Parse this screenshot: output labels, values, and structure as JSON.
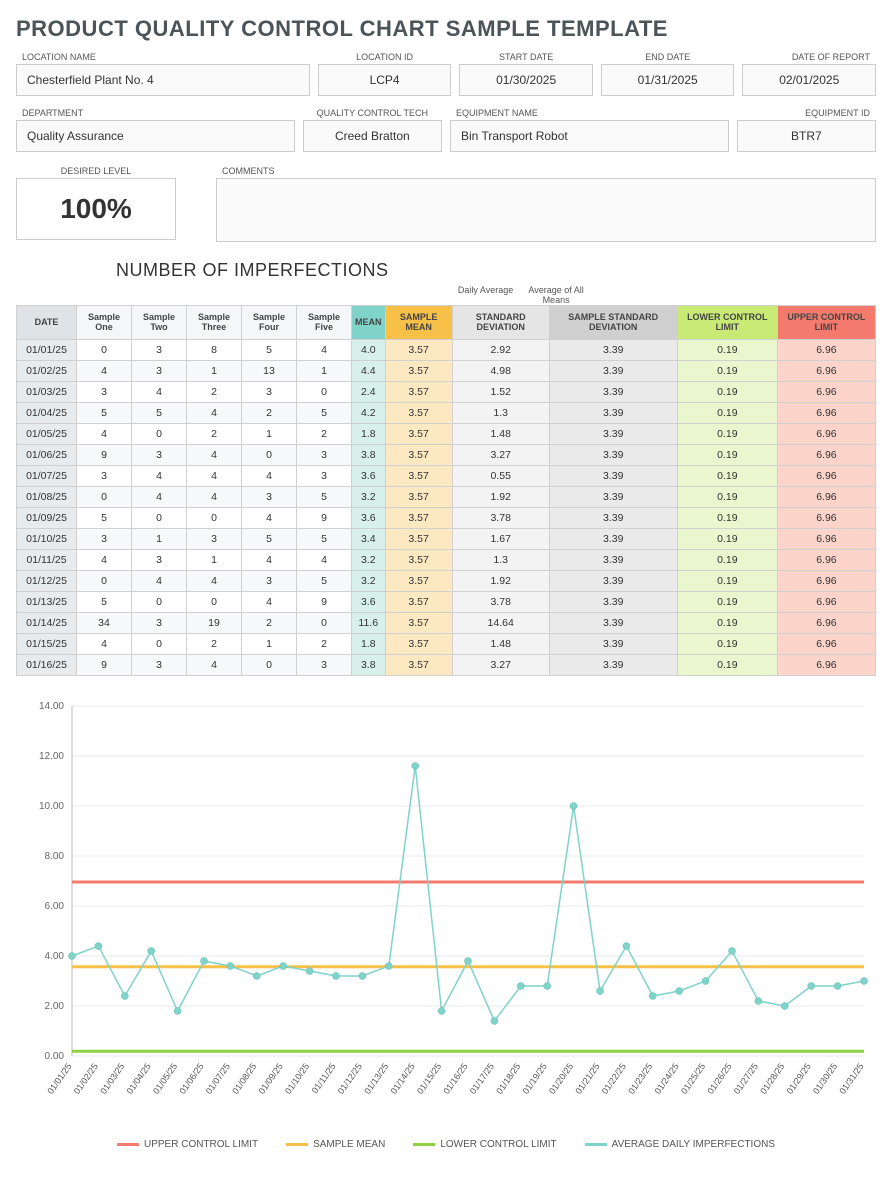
{
  "title": "PRODUCT QUALITY CONTROL CHART SAMPLE TEMPLATE",
  "fields1": {
    "location_name": {
      "label": "LOCATION NAME",
      "value": "Chesterfield Plant No. 4"
    },
    "location_id": {
      "label": "LOCATION ID",
      "value": "LCP4"
    },
    "start_date": {
      "label": "START DATE",
      "value": "01/30/2025"
    },
    "end_date": {
      "label": "END DATE",
      "value": "01/31/2025"
    },
    "report_date": {
      "label": "DATE OF REPORT",
      "value": "02/01/2025"
    }
  },
  "fields2": {
    "department": {
      "label": "DEPARTMENT",
      "value": "Quality Assurance"
    },
    "qc_tech": {
      "label": "QUALITY CONTROL TECH",
      "value": "Creed Bratton"
    },
    "equip_name": {
      "label": "EQUIPMENT NAME",
      "value": "Bin Transport Robot"
    },
    "equip_id": {
      "label": "EQUIPMENT ID",
      "value": "BTR7"
    }
  },
  "desired": {
    "label": "DESIRED LEVEL",
    "value": "100%"
  },
  "comments": {
    "label": "COMMENTS",
    "value": ""
  },
  "table": {
    "title": "NUMBER OF IMPERFECTIONS",
    "supheader_daily": "Daily Average",
    "supheader_all": "Average of All Means",
    "headers": {
      "date": "DATE",
      "s1": "Sample One",
      "s2": "Sample Two",
      "s3": "Sample Three",
      "s4": "Sample Four",
      "s5": "Sample Five",
      "mean": "MEAN",
      "smean": "SAMPLE MEAN",
      "std": "STANDARD DEVIATION",
      "sstd": "SAMPLE STANDARD DEVIATION",
      "lcl": "LOWER CONTROL LIMIT",
      "ucl": "UPPER CONTROL LIMIT"
    },
    "rows": [
      {
        "date": "01/01/25",
        "s1": 0,
        "s2": 3,
        "s3": 8,
        "s4": 5,
        "s5": 4,
        "mean": 4.0,
        "smean": 3.57,
        "std": 2.92,
        "sstd": 3.39,
        "lcl": 0.19,
        "ucl": 6.96
      },
      {
        "date": "01/02/25",
        "s1": 4,
        "s2": 3,
        "s3": 1,
        "s4": 13,
        "s5": 1,
        "mean": 4.4,
        "smean": 3.57,
        "std": 4.98,
        "sstd": 3.39,
        "lcl": 0.19,
        "ucl": 6.96
      },
      {
        "date": "01/03/25",
        "s1": 3,
        "s2": 4,
        "s3": 2,
        "s4": 3,
        "s5": 0,
        "mean": 2.4,
        "smean": 3.57,
        "std": 1.52,
        "sstd": 3.39,
        "lcl": 0.19,
        "ucl": 6.96
      },
      {
        "date": "01/04/25",
        "s1": 5,
        "s2": 5,
        "s3": 4,
        "s4": 2,
        "s5": 5,
        "mean": 4.2,
        "smean": 3.57,
        "std": 1.3,
        "sstd": 3.39,
        "lcl": 0.19,
        "ucl": 6.96
      },
      {
        "date": "01/05/25",
        "s1": 4,
        "s2": 0,
        "s3": 2,
        "s4": 1,
        "s5": 2,
        "mean": 1.8,
        "smean": 3.57,
        "std": 1.48,
        "sstd": 3.39,
        "lcl": 0.19,
        "ucl": 6.96
      },
      {
        "date": "01/06/25",
        "s1": 9,
        "s2": 3,
        "s3": 4,
        "s4": 0,
        "s5": 3,
        "mean": 3.8,
        "smean": 3.57,
        "std": 3.27,
        "sstd": 3.39,
        "lcl": 0.19,
        "ucl": 6.96
      },
      {
        "date": "01/07/25",
        "s1": 3,
        "s2": 4,
        "s3": 4,
        "s4": 4,
        "s5": 3,
        "mean": 3.6,
        "smean": 3.57,
        "std": 0.55,
        "sstd": 3.39,
        "lcl": 0.19,
        "ucl": 6.96
      },
      {
        "date": "01/08/25",
        "s1": 0,
        "s2": 4,
        "s3": 4,
        "s4": 3,
        "s5": 5,
        "mean": 3.2,
        "smean": 3.57,
        "std": 1.92,
        "sstd": 3.39,
        "lcl": 0.19,
        "ucl": 6.96
      },
      {
        "date": "01/09/25",
        "s1": 5,
        "s2": 0,
        "s3": 0,
        "s4": 4,
        "s5": 9,
        "mean": 3.6,
        "smean": 3.57,
        "std": 3.78,
        "sstd": 3.39,
        "lcl": 0.19,
        "ucl": 6.96
      },
      {
        "date": "01/10/25",
        "s1": 3,
        "s2": 1,
        "s3": 3,
        "s4": 5,
        "s5": 5,
        "mean": 3.4,
        "smean": 3.57,
        "std": 1.67,
        "sstd": 3.39,
        "lcl": 0.19,
        "ucl": 6.96
      },
      {
        "date": "01/11/25",
        "s1": 4,
        "s2": 3,
        "s3": 1,
        "s4": 4,
        "s5": 4,
        "mean": 3.2,
        "smean": 3.57,
        "std": 1.3,
        "sstd": 3.39,
        "lcl": 0.19,
        "ucl": 6.96
      },
      {
        "date": "01/12/25",
        "s1": 0,
        "s2": 4,
        "s3": 4,
        "s4": 3,
        "s5": 5,
        "mean": 3.2,
        "smean": 3.57,
        "std": 1.92,
        "sstd": 3.39,
        "lcl": 0.19,
        "ucl": 6.96
      },
      {
        "date": "01/13/25",
        "s1": 5,
        "s2": 0,
        "s3": 0,
        "s4": 4,
        "s5": 9,
        "mean": 3.6,
        "smean": 3.57,
        "std": 3.78,
        "sstd": 3.39,
        "lcl": 0.19,
        "ucl": 6.96
      },
      {
        "date": "01/14/25",
        "s1": 34,
        "s2": 3,
        "s3": 19,
        "s4": 2,
        "s5": 0,
        "mean": 11.6,
        "smean": 3.57,
        "std": 14.64,
        "sstd": 3.39,
        "lcl": 0.19,
        "ucl": 6.96
      },
      {
        "date": "01/15/25",
        "s1": 4,
        "s2": 0,
        "s3": 2,
        "s4": 1,
        "s5": 2,
        "mean": 1.8,
        "smean": 3.57,
        "std": 1.48,
        "sstd": 3.39,
        "lcl": 0.19,
        "ucl": 6.96
      },
      {
        "date": "01/16/25",
        "s1": 9,
        "s2": 3,
        "s3": 4,
        "s4": 0,
        "s5": 3,
        "mean": 3.8,
        "smean": 3.57,
        "std": 3.27,
        "sstd": 3.39,
        "lcl": 0.19,
        "ucl": 6.96
      }
    ]
  },
  "chart_data": {
    "type": "line",
    "title": "",
    "ylabel": "",
    "xlabel": "",
    "ylim": [
      0,
      14
    ],
    "yticks": [
      0,
      2,
      4,
      6,
      8,
      10,
      12,
      14
    ],
    "categories": [
      "01/01/25",
      "01/02/25",
      "01/03/25",
      "01/04/25",
      "01/05/25",
      "01/06/25",
      "01/07/25",
      "01/08/25",
      "01/09/25",
      "01/10/25",
      "01/11/25",
      "01/12/25",
      "01/13/25",
      "01/14/25",
      "01/15/25",
      "01/16/25",
      "01/17/25",
      "01/18/25",
      "01/19/25",
      "01/20/25",
      "01/21/25",
      "01/22/25",
      "01/23/25",
      "01/24/25",
      "01/25/25",
      "01/26/25",
      "01/27/25",
      "01/28/25",
      "01/29/25",
      "01/30/25",
      "01/31/25"
    ],
    "series": [
      {
        "name": "UPPER CONTROL LIMIT",
        "color": "#f47a6e",
        "values": [
          6.96,
          6.96,
          6.96,
          6.96,
          6.96,
          6.96,
          6.96,
          6.96,
          6.96,
          6.96,
          6.96,
          6.96,
          6.96,
          6.96,
          6.96,
          6.96,
          6.96,
          6.96,
          6.96,
          6.96,
          6.96,
          6.96,
          6.96,
          6.96,
          6.96,
          6.96,
          6.96,
          6.96,
          6.96,
          6.96,
          6.96
        ]
      },
      {
        "name": "SAMPLE MEAN",
        "color": "#f6c049",
        "values": [
          3.57,
          3.57,
          3.57,
          3.57,
          3.57,
          3.57,
          3.57,
          3.57,
          3.57,
          3.57,
          3.57,
          3.57,
          3.57,
          3.57,
          3.57,
          3.57,
          3.57,
          3.57,
          3.57,
          3.57,
          3.57,
          3.57,
          3.57,
          3.57,
          3.57,
          3.57,
          3.57,
          3.57,
          3.57,
          3.57,
          3.57
        ]
      },
      {
        "name": "LOWER CONTROL LIMIT",
        "color": "#8fd142",
        "values": [
          0.19,
          0.19,
          0.19,
          0.19,
          0.19,
          0.19,
          0.19,
          0.19,
          0.19,
          0.19,
          0.19,
          0.19,
          0.19,
          0.19,
          0.19,
          0.19,
          0.19,
          0.19,
          0.19,
          0.19,
          0.19,
          0.19,
          0.19,
          0.19,
          0.19,
          0.19,
          0.19,
          0.19,
          0.19,
          0.19,
          0.19
        ]
      },
      {
        "name": "AVERAGE DAILY IMPERFECTIONS",
        "color": "#7fd3c9",
        "values": [
          4.0,
          4.4,
          2.4,
          4.2,
          1.8,
          3.8,
          3.6,
          3.2,
          3.6,
          3.4,
          3.2,
          3.2,
          3.6,
          11.6,
          1.8,
          3.8,
          1.4,
          2.8,
          2.8,
          10.0,
          2.6,
          4.4,
          2.4,
          2.6,
          3.0,
          4.2,
          2.2,
          2.0,
          2.8,
          2.8,
          3.0
        ]
      }
    ],
    "legend": [
      "UPPER CONTROL LIMIT",
      "SAMPLE MEAN",
      "LOWER CONTROL LIMIT",
      "AVERAGE DAILY IMPERFECTIONS"
    ]
  }
}
